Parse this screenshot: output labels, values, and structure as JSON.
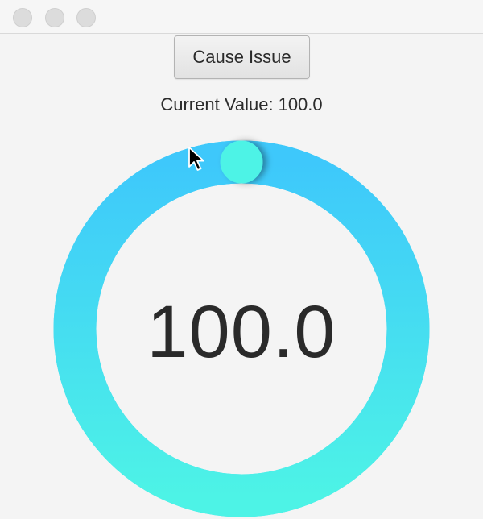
{
  "window": {
    "controls": [
      "close",
      "minimize",
      "zoom"
    ]
  },
  "toolbar": {
    "cause_issue_label": "Cause Issue"
  },
  "status": {
    "current_value_label": "Current Value:",
    "current_value": "100.0"
  },
  "gauge": {
    "display_value": "100.0",
    "value": 100.0,
    "max": 100.0,
    "fraction": 1.0,
    "colors": {
      "start": "#4df3e6",
      "end": "#3ec8fb",
      "track": "#3fd6f6"
    }
  },
  "icons": {
    "pointer": "mouse-pointer-icon"
  }
}
